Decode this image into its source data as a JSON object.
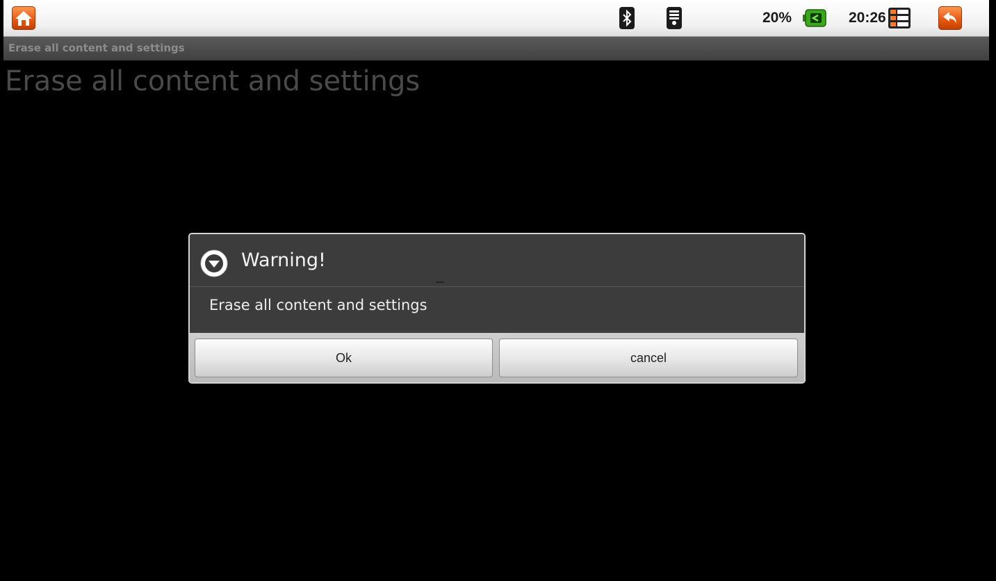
{
  "status_bar": {
    "battery_text": "20%",
    "clock": "20:26",
    "icons": [
      "home-icon",
      "bluetooth-icon",
      "wifi-icon",
      "battery-icon",
      "menu-icon",
      "back-icon"
    ],
    "colors": {
      "accent_orange": "#e85a12",
      "battery_green": "#3aa81b"
    }
  },
  "title_bar": {
    "title": "Erase all content and settings"
  },
  "page": {
    "heading": "Erase all content and settings"
  },
  "dialog": {
    "title": "Warning!",
    "icon": "warning-icon",
    "message": "Erase all content and settings",
    "ok_label": "Ok",
    "cancel_label": "cancel"
  }
}
